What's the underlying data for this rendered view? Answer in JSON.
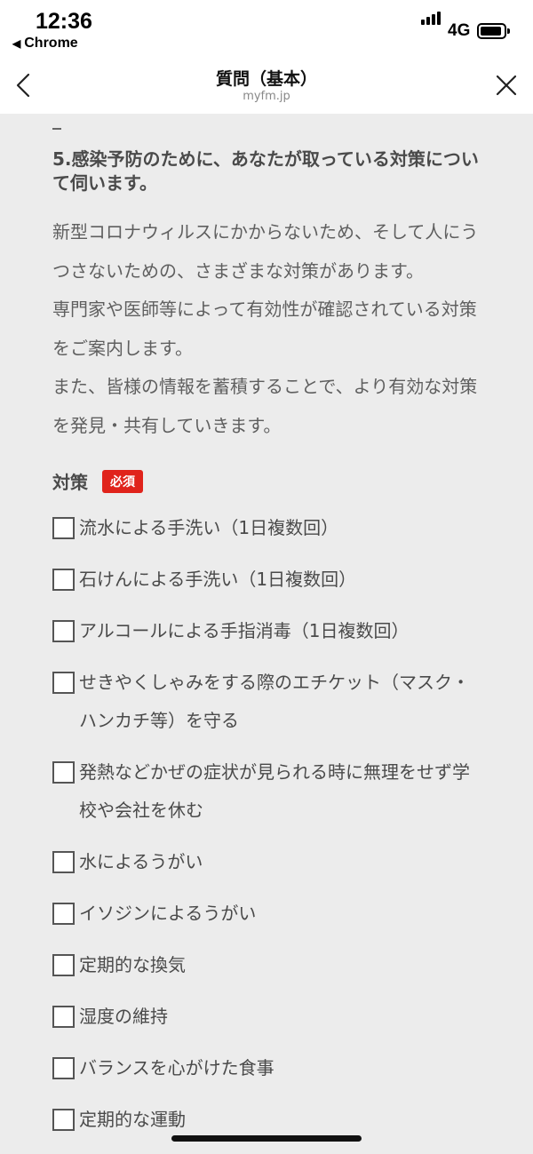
{
  "status": {
    "time": "12:36",
    "back_app": "Chrome",
    "network": "4G"
  },
  "nav": {
    "title": "質問（基本）",
    "subtitle": "myfm.jp",
    "back_icon": "chevron-left-icon",
    "close_icon": "close-icon"
  },
  "question": {
    "title": "5.感染予防のために、あなたが取っている対策について伺います。",
    "intro": [
      "新型コロナウィルスにかからないため、そして人にうつさないための、さまざまな対策があります。",
      "専門家や医師等によって有効性が確認されている対策をご案内します。",
      "また、皆様の情報を蓄積することで、より有効な対策を発見・共有していきます。"
    ]
  },
  "field": {
    "label": "対策",
    "required_badge": "必須",
    "options": [
      "流水による手洗い（1日複数回）",
      "石けんによる手洗い（1日複数回）",
      "アルコールによる手指消毒（1日複数回）",
      "せきやくしゃみをする際のエチケット（マスク・ハンカチ等）を守る",
      "発熱などかぜの症状が見られる時に無理をせず学校や会社を休む",
      "水によるうがい",
      "イソジンによるうがい",
      "定期的な換気",
      "湿度の維持",
      "バランスを心がけた食事",
      "定期的な運動"
    ]
  },
  "colors": {
    "required": "#e0231b",
    "background": "#ececec"
  }
}
